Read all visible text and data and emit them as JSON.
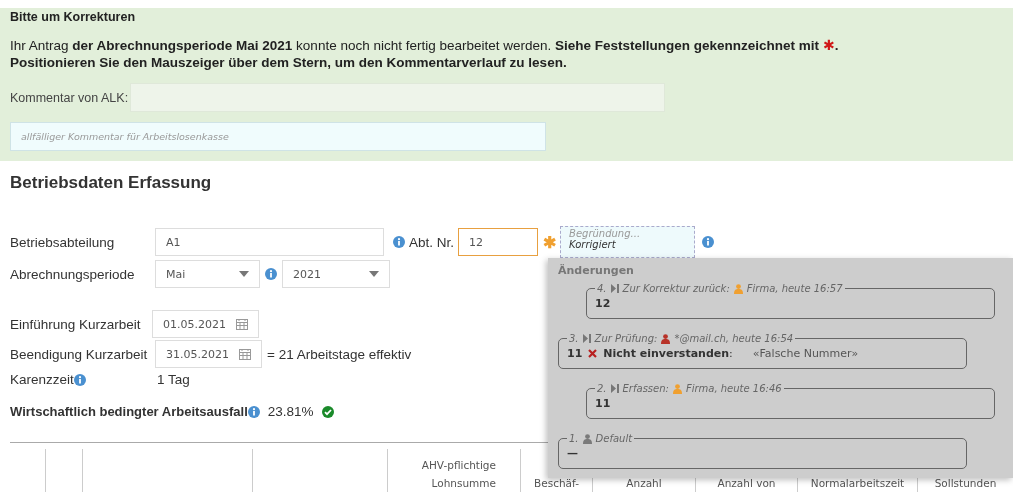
{
  "notice": {
    "title": "Bitte um Korrekturen",
    "message": {
      "text": "Ihr Antrag **der Abrechnungsperiode Mai 2021** konnte noch nicht fertig bearbeitet werden. **Siehe Feststellungen gekennzeichnet mit**",
      "marker": "✱",
      "after": "."
    },
    "hint": "Positionieren Sie den Mauszeiger über dem Stern, um den Kommentarverlauf zu lesen.",
    "comment_label": "Kommentar von ALK:",
    "comment_placeholder": "allfälliger Kommentar für Arbeitslosenkasse"
  },
  "section_title": "Betriebsdaten Erfassung",
  "department": {
    "label": "Betriebsabteilung",
    "value": "A1",
    "number_label": "Abt. Nr.",
    "number_value": "12",
    "flagged": true,
    "flag_marker": "✱",
    "reason_placeholder": "Begründung...",
    "reason_value": "Korrigiert"
  },
  "period": {
    "label": "Abrechnungsperiode",
    "month": "Mai",
    "year": "2021"
  },
  "start": {
    "label": "Einführung Kurzarbeit",
    "value": "01.05.2021"
  },
  "end": {
    "label": "Beendigung Kurzarbeit",
    "value": "31.05.2021",
    "note": "= 21 Arbeitstage effektiv"
  },
  "waiting": {
    "label": "Karenzzeit",
    "value": "1 Tag"
  },
  "loss": {
    "label": "Wirtschaftlich bedingter Arbeitsausfall",
    "value": "23.81%",
    "ok": true
  },
  "table": {
    "columns": [
      "",
      "",
      "",
      "",
      [
        "AHV-pflichtige",
        "Lohnsumme"
      ],
      [
        "",
        "Beschäf-"
      ],
      [
        "",
        "Anzahl"
      ],
      [
        "",
        "Anzahl von"
      ],
      [
        "",
        "Normalarbeitszeit"
      ],
      [
        "",
        "Sollstunden"
      ]
    ]
  },
  "changes": {
    "title": "Änderungen",
    "entries": [
      {
        "kind": "company",
        "number": "4.",
        "action": "Zur Korrektur zurück:",
        "user": "Firma, heute 16:57",
        "color": "#f0a030",
        "value": "12"
      },
      {
        "kind": "office",
        "number": "3.",
        "action": "Zur Prüfung:",
        "user": "*@mail.ch, heute 16:54",
        "color": "#b83228",
        "value": "11",
        "verdict": "Nicht einverstanden",
        "verdict_separator": ":",
        "comment": "«Falsche Nummer»"
      },
      {
        "kind": "company",
        "number": "2.",
        "action": "Erfassen:",
        "user": "Firma, heute 16:46",
        "color": "#f0a030",
        "value": "11"
      },
      {
        "kind": "default",
        "number": "1.",
        "user": "Default",
        "color": "#7a7a7a",
        "value": "—"
      }
    ]
  }
}
